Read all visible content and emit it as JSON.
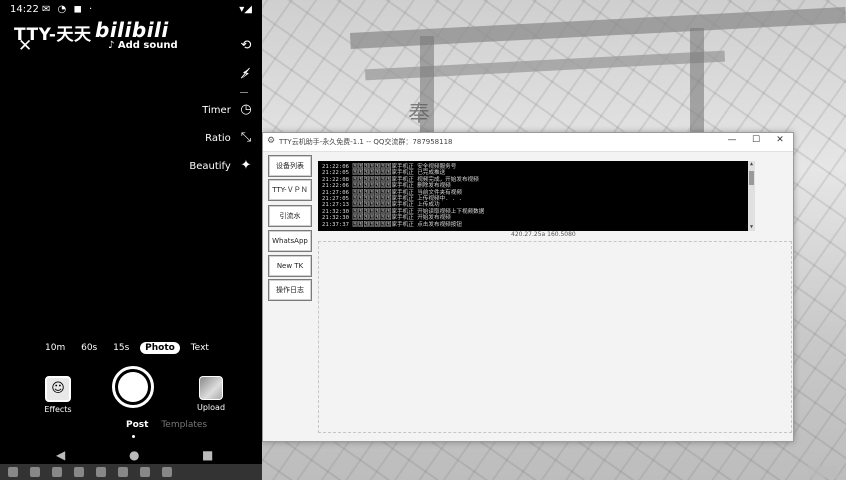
{
  "phone": {
    "status": {
      "time": "14:22",
      "icons": "✉ ◔ ◼ ·",
      "right": "▾◢"
    },
    "watermark": "TTY-天天",
    "watermark_logo": "bilibili",
    "close_icon": "✕",
    "add_sound": "♪ Add sound",
    "side_controls": {
      "flip": "",
      "flash": "",
      "timer": "Timer",
      "ratio": "Ratio",
      "beautify": "Beautify"
    },
    "icons": {
      "flip": "⟲",
      "flash": "⚡̸",
      "timer": "◷",
      "ratio": "⤡",
      "beautify": "✦"
    },
    "modes": [
      "10m",
      "60s",
      "15s",
      "Photo",
      "Text"
    ],
    "active_mode": "Photo",
    "effects_label": "Effects",
    "upload_label": "Upload",
    "post_tabs": [
      "Post",
      "Templates"
    ],
    "nav": {
      "back": "◀",
      "home": "●",
      "recents": "■"
    }
  },
  "window": {
    "title": "TTY云机助手-永久免费-1.1 -- QQ交流群：787958118",
    "controls": {
      "minimize": "—",
      "maximize": "☐",
      "close": "✕"
    },
    "side_buttons": [
      "设备列表",
      "TTY-ＶＰＮ",
      "引流水",
      "WhatsApp",
      "New TK",
      "操作日志"
    ],
    "log_lines": [
      "21:22:06  国国国国国国国家手机正  安全视频服务号",
      "21:22:05  国国国国国国国家手机正  已完成推送",
      "21:22:08  国国国国国国国家手机正  视频完成，开始发布视频",
      "21:22:06  国国国国国国国家手机正  删除发布视频",
      "21:27:06  国国国国国国国家手机正  当前文件夹有视频",
      "21:27:05  国国国国国国国家手机正  上传视频中. . .",
      "21:27:13  国国国国国国国家手机正  上传成功",
      "21:32:30  国国国国国国国家手机正  开始读取视频上下视频数据",
      "21:32:30  国国国国国国国家手机正  开始发布视频",
      "21:37:37  国国国国国国国家手机正  点击发布视频按钮"
    ],
    "resolution": "420.27.25a 160.5080"
  }
}
